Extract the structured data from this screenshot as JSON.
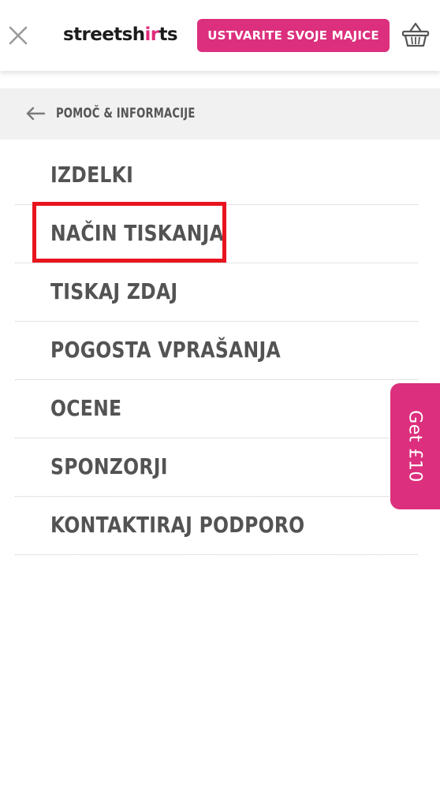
{
  "header": {
    "logo_prefix": "streetsh",
    "logo_mark": "ir",
    "logo_suffix": "ts",
    "cta_label": "USTVARITE SVOJE MAJICE",
    "close_icon": "close-icon",
    "basket_icon": "basket-icon"
  },
  "breadcrumb": {
    "back_icon": "arrow-left-icon",
    "label": "POMOČ & INFORMACIJE"
  },
  "menu": {
    "items": [
      {
        "label": "IZDELKI"
      },
      {
        "label": "NAČIN TISKANJA"
      },
      {
        "label": "TISKAJ ZDAJ"
      },
      {
        "label": "POGOSTA VPRAŠANJA"
      },
      {
        "label": "OCENE"
      },
      {
        "label": "SPONZORJI"
      },
      {
        "label": "KONTAKTIRAJ PODPORO"
      }
    ]
  },
  "promo": {
    "label": "Get £10"
  },
  "colors": {
    "brand_pink": "#dc2f7d",
    "highlight_red": "#e8141e",
    "menu_text": "#535353",
    "breadcrumb_bg": "#f1f1f1"
  }
}
